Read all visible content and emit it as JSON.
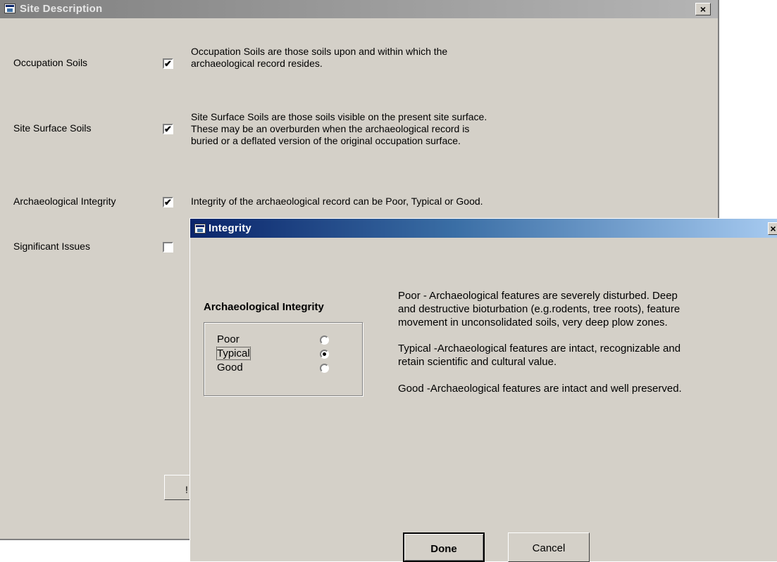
{
  "site_window": {
    "title": "Site Description",
    "close_glyph": "×",
    "rows": [
      {
        "label": "Occupation Soils",
        "checked": true,
        "description": [
          "Occupation Soils are those soils upon and within which the",
          "archaeological record resides."
        ]
      },
      {
        "label": "Site Surface Soils",
        "checked": true,
        "description": [
          "Site Surface Soils are those soils visible on the present site surface.",
          "These may be an overburden when the archaeological record is",
          "buried or a deflated version of the original occupation surface."
        ]
      },
      {
        "label": "Archaeological Integrity",
        "checked": true,
        "description": [
          "Integrity of the archaeological record can be Poor, Typical or Good."
        ]
      },
      {
        "label": "Significant Issues",
        "checked": false,
        "description": []
      }
    ],
    "hidden_button_glyph": "!",
    "check_glyph": "✔"
  },
  "integrity_dialog": {
    "title": "Integrity",
    "close_glyph": "×",
    "group_title": "Archaeological Integrity",
    "options": [
      {
        "label": "Poor",
        "selected": false
      },
      {
        "label": "Typical",
        "selected": true
      },
      {
        "label": "Good",
        "selected": false
      }
    ],
    "info": [
      [
        "Poor -  Archaeological features are severely disturbed. Deep",
        "and destructive bioturbation (e.g.rodents, tree roots), feature",
        "movement in unconsolidated soils, very deep plow zones."
      ],
      [
        "Typical -Archaeological features are intact, recognizable  and",
        "retain scientific and cultural value."
      ],
      [
        "Good -Archaeological features are intact and well preserved."
      ]
    ],
    "done_label": "Done",
    "cancel_label": "Cancel"
  }
}
